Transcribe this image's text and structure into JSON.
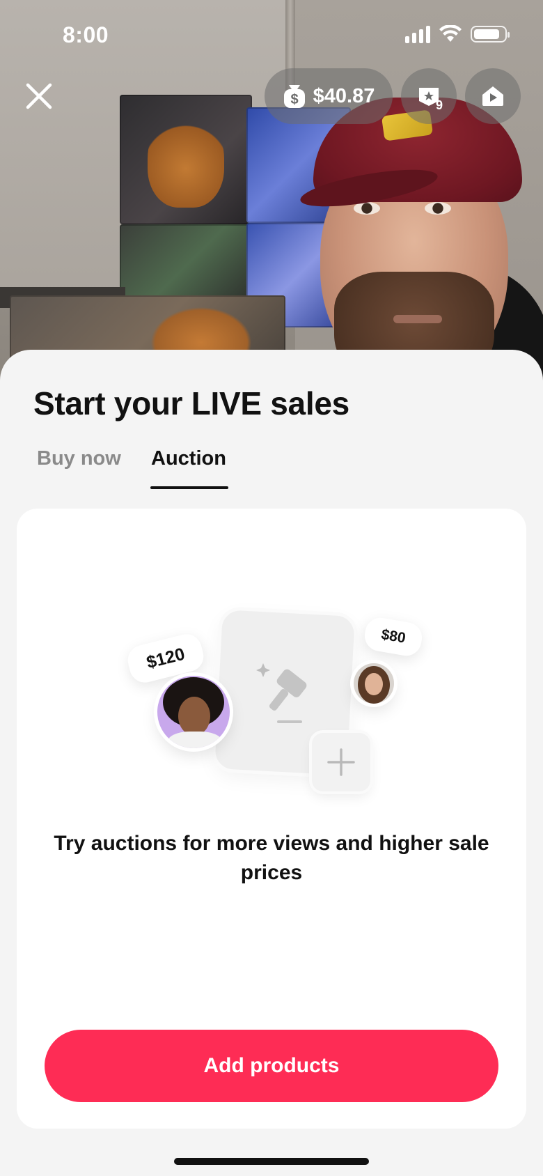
{
  "status_bar": {
    "time": "8:00"
  },
  "top_bar": {
    "wallet_amount": "$40.87",
    "gift_badge_count": "9"
  },
  "sheet": {
    "title": "Start your LIVE sales",
    "tabs": [
      {
        "label": "Buy now",
        "selected": false
      },
      {
        "label": "Auction",
        "selected": true
      }
    ],
    "illustration": {
      "bid_left": "$120",
      "bid_right": "$80"
    },
    "promo_text": "Try auctions for more views and higher sale prices",
    "primary_button": "Add products"
  },
  "colors": {
    "accent": "#fe2c55",
    "sheet_background": "#f4f4f4",
    "card_background": "#ffffff"
  },
  "icons": [
    "close-icon",
    "wallet-icon",
    "gift-icon",
    "share-icon",
    "hammer-icon",
    "plus-icon",
    "signal-icon",
    "wifi-icon",
    "battery-icon"
  ]
}
